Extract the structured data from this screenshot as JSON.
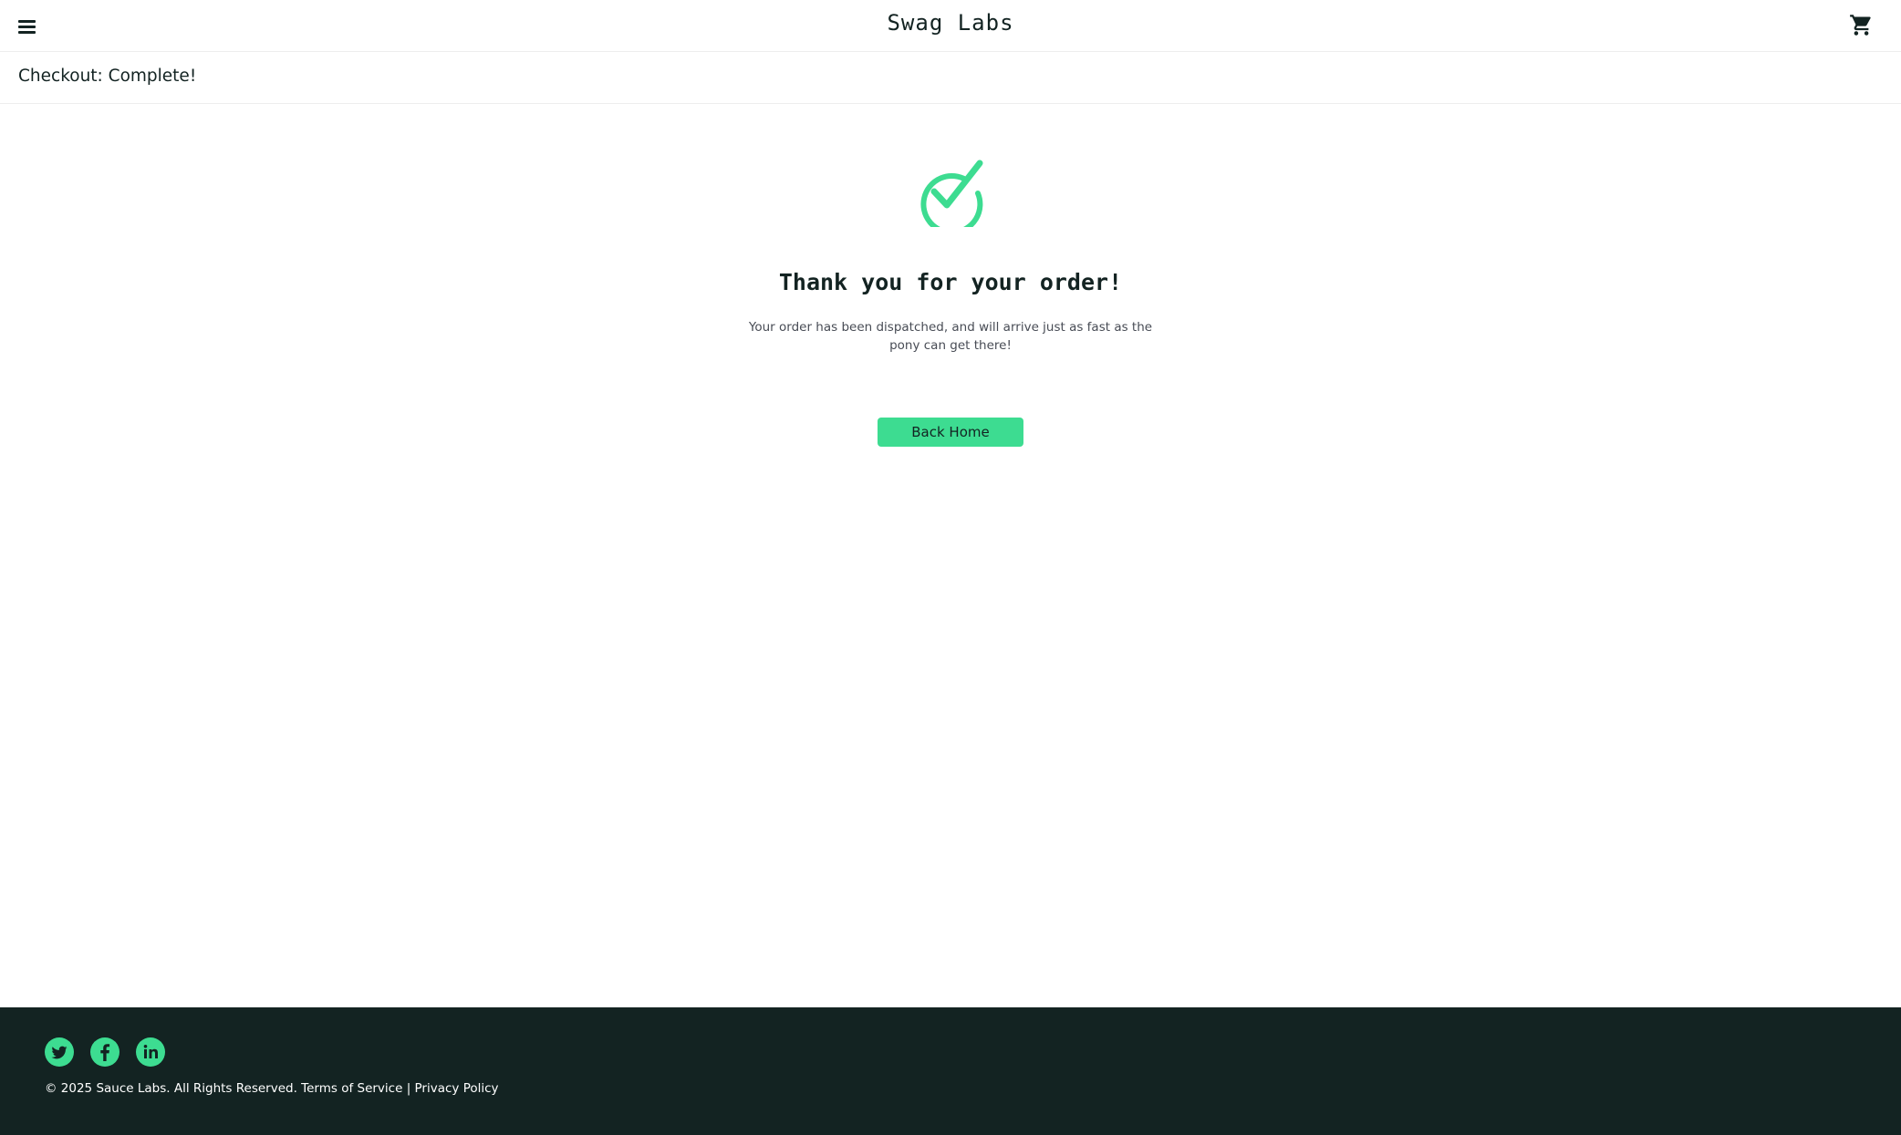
{
  "header": {
    "menu_icon": "hamburger-menu-icon",
    "app_title": "Swag Labs",
    "cart_icon": "shopping-cart-icon"
  },
  "secondary_header": {
    "title": "Checkout: Complete!"
  },
  "complete": {
    "icon": "checkmark-circle-icon",
    "heading": "Thank you for your order!",
    "message": "Your order has been dispatched, and will arrive just as fast as the pony can get there!",
    "back_home_label": "Back Home"
  },
  "footer": {
    "social_icons": [
      "twitter-icon",
      "facebook-icon",
      "linkedin-icon"
    ],
    "copyright": "© 2025 Sauce Labs. All Rights Reserved. Terms of Service | Privacy Policy"
  },
  "colors": {
    "accent": "#3ddc91",
    "text_dark": "#132322",
    "footer_bg": "#132322",
    "muted_text": "#484c55"
  }
}
